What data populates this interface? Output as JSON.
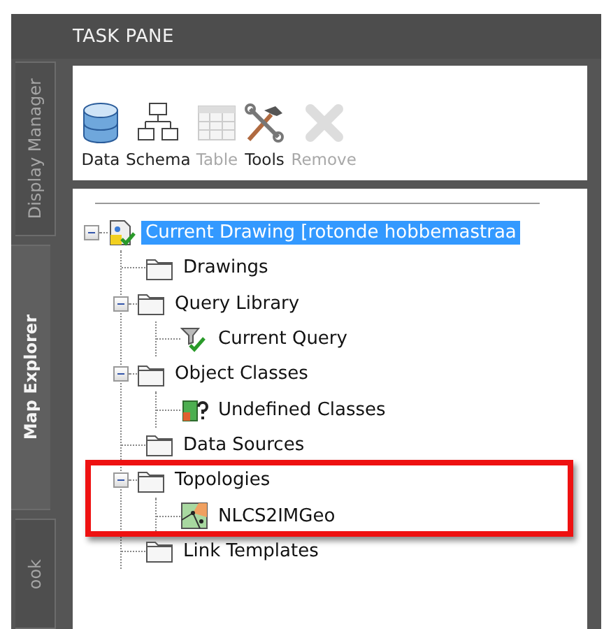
{
  "window": {
    "title": "TASK PANE"
  },
  "side_tabs": [
    {
      "label": "Display Manager",
      "selected": false
    },
    {
      "label": "Map Explorer",
      "selected": true
    },
    {
      "label": "ook",
      "selected": false
    }
  ],
  "toolbar": [
    {
      "kind": "data",
      "label": "Data",
      "disabled": false
    },
    {
      "kind": "schema",
      "label": "Schema",
      "disabled": false
    },
    {
      "kind": "table",
      "label": "Table",
      "disabled": true
    },
    {
      "kind": "tools",
      "label": "Tools",
      "disabled": false
    },
    {
      "kind": "remove",
      "label": "Remove",
      "disabled": true
    }
  ],
  "tree": [
    {
      "kind": "drawing",
      "label": "Current Drawing [rotonde hobbemastraa",
      "selected": true,
      "expanded": true,
      "highlighted": false,
      "children": [
        {
          "kind": "folder",
          "label": "Drawings",
          "selected": false,
          "highlighted": false
        },
        {
          "kind": "folder",
          "label": "Query Library",
          "selected": false,
          "expanded": true,
          "highlighted": false,
          "children": [
            {
              "kind": "query",
              "label": "Current Query",
              "selected": false,
              "highlighted": false
            }
          ]
        },
        {
          "kind": "folder",
          "label": "Object Classes",
          "selected": false,
          "expanded": true,
          "highlighted": false,
          "children": [
            {
              "kind": "classes",
              "label": "Undefined Classes",
              "selected": false,
              "highlighted": false
            }
          ]
        },
        {
          "kind": "folder",
          "label": "Data Sources",
          "selected": false,
          "highlighted": false
        },
        {
          "kind": "folder",
          "label": "Topologies",
          "selected": false,
          "expanded": true,
          "highlighted": true,
          "children": [
            {
              "kind": "topology",
              "label": "NLCS2IMGeo",
              "selected": false,
              "highlighted": false
            }
          ]
        },
        {
          "kind": "folder",
          "label": "Link Templates",
          "selected": false,
          "highlighted": false
        }
      ]
    }
  ]
}
